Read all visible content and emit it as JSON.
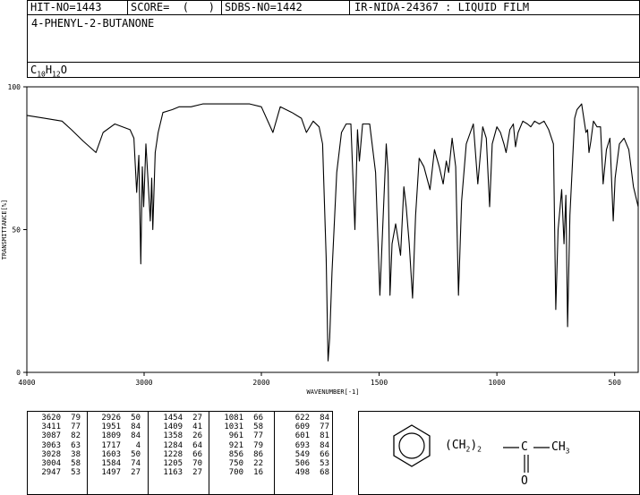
{
  "header": {
    "hit_no": "HIT-NO=1443",
    "score": "SCORE=  (   )",
    "sdbs_no": "SDBS-NO=1442",
    "ir_info": "IR-NIDA-24367 : LIQUID FILM"
  },
  "compound_name": "4-PHENYL-2-BUTANONE",
  "formula": {
    "c": "C",
    "c_n": "10",
    "h": "H",
    "h_n": "12",
    "o": "O"
  },
  "structure": {
    "chain_label": "(CH",
    "chain_sub": "2",
    "chain_close": ")",
    "chain_count": "2",
    "carbon": "C",
    "methyl": "CH",
    "methyl_sub": "3",
    "oxygen": "O"
  },
  "chart_data": {
    "type": "line",
    "xlabel": "WAVENUMBER[-1]",
    "ylabel": "TRANSMITTANCE[%]",
    "xlim": [
      4000,
      400
    ],
    "ylim": [
      0,
      100
    ],
    "x_ticks": [
      "4000",
      "3000",
      "2000",
      "1500",
      "1000",
      "500"
    ],
    "y_ticks": [
      "100",
      "50",
      "0"
    ],
    "series": [
      {
        "x": [
          4000,
          3850,
          3700,
          3620,
          3520,
          3411,
          3350,
          3250,
          3120,
          3087,
          3063,
          3045,
          3028,
          3015,
          3004,
          2985,
          2965,
          2947,
          2935,
          2926,
          2905,
          2880,
          2840,
          2760,
          2700,
          2600,
          2500,
          2400,
          2300,
          2200,
          2100,
          2000,
          1951,
          1920,
          1870,
          1830,
          1809,
          1780,
          1755,
          1740,
          1725,
          1717,
          1710,
          1700,
          1680,
          1660,
          1640,
          1620,
          1603,
          1592,
          1584,
          1570,
          1560,
          1540,
          1515,
          1497,
          1480,
          1470,
          1462,
          1454,
          1445,
          1430,
          1409,
          1395,
          1385,
          1372,
          1358,
          1345,
          1330,
          1310,
          1284,
          1265,
          1245,
          1228,
          1215,
          1205,
          1190,
          1175,
          1163,
          1150,
          1130,
          1100,
          1081,
          1060,
          1045,
          1031,
          1020,
          1000,
          985,
          970,
          961,
          945,
          930,
          921,
          910,
          890,
          870,
          856,
          840,
          820,
          800,
          780,
          760,
          750,
          740,
          725,
          715,
          707,
          700,
          690,
          670,
          660,
          640,
          622,
          615,
          609,
          601,
          590,
          575,
          560,
          549,
          535,
          520,
          506,
          498,
          480,
          460,
          440,
          420,
          400
        ],
        "y": [
          90,
          89,
          88,
          85,
          81,
          77,
          84,
          87,
          85,
          82,
          63,
          76,
          38,
          72,
          58,
          80,
          66,
          53,
          68,
          50,
          77,
          84,
          91,
          92,
          93,
          93,
          94,
          94,
          94,
          94,
          94,
          93,
          84,
          93,
          91,
          89,
          84,
          88,
          86,
          80,
          40,
          4,
          12,
          35,
          70,
          84,
          87,
          87,
          50,
          85,
          74,
          87,
          87,
          87,
          70,
          27,
          60,
          80,
          70,
          27,
          45,
          52,
          41,
          65,
          58,
          45,
          26,
          55,
          75,
          72,
          64,
          78,
          72,
          66,
          74,
          70,
          82,
          72,
          27,
          60,
          80,
          87,
          66,
          86,
          82,
          58,
          80,
          86,
          84,
          80,
          77,
          85,
          87,
          79,
          84,
          88,
          87,
          86,
          88,
          87,
          88,
          85,
          80,
          22,
          50,
          64,
          45,
          62,
          16,
          55,
          89,
          92,
          94,
          84,
          85,
          77,
          81,
          88,
          86,
          86,
          66,
          78,
          82,
          53,
          68,
          80,
          82,
          78,
          65,
          58
        ]
      }
    ],
    "peak_table": [
      [
        "3620",
        "79"
      ],
      [
        "3411",
        "77"
      ],
      [
        "3087",
        "82"
      ],
      [
        "3063",
        "63"
      ],
      [
        "3028",
        "38"
      ],
      [
        "3004",
        "58"
      ],
      [
        "2947",
        "53"
      ],
      [
        "2926",
        "50"
      ],
      [
        "1951",
        "84"
      ],
      [
        "1809",
        "84"
      ],
      [
        "1717",
        "4"
      ],
      [
        "1603",
        "50"
      ],
      [
        "1584",
        "74"
      ],
      [
        "1497",
        "27"
      ],
      [
        "1454",
        "27"
      ],
      [
        "1409",
        "41"
      ],
      [
        "1358",
        "26"
      ],
      [
        "1284",
        "64"
      ],
      [
        "1228",
        "66"
      ],
      [
        "1205",
        "70"
      ],
      [
        "1163",
        "27"
      ],
      [
        "1081",
        "66"
      ],
      [
        "1031",
        "58"
      ],
      [
        "961",
        "77"
      ],
      [
        "921",
        "79"
      ],
      [
        "856",
        "86"
      ],
      [
        "750",
        "22"
      ],
      [
        "700",
        "16"
      ],
      [
        "622",
        "84"
      ],
      [
        "609",
        "77"
      ],
      [
        "601",
        "81"
      ],
      [
        "693",
        "84"
      ],
      [
        "549",
        "66"
      ],
      [
        "506",
        "53"
      ],
      [
        "498",
        "68"
      ]
    ]
  }
}
